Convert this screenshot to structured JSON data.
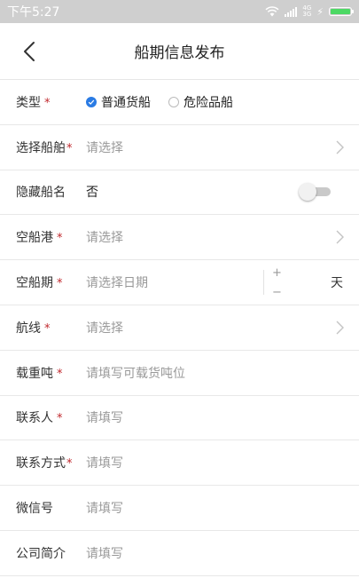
{
  "status": {
    "time": "下午5:27",
    "network_top": "4G",
    "network_bottom": "3G"
  },
  "header": {
    "title": "船期信息发布"
  },
  "form": {
    "required_mark": "*",
    "type": {
      "label": "类型",
      "options": [
        {
          "label": "普通货船",
          "selected": true
        },
        {
          "label": "危险品船",
          "selected": false
        }
      ]
    },
    "ship": {
      "label": "选择船舶",
      "placeholder": "请选择"
    },
    "hide_name": {
      "label": "隐藏船名",
      "value": "否",
      "toggle_on": false
    },
    "port": {
      "label": "空船港",
      "placeholder": "请选择"
    },
    "date": {
      "label": "空船期",
      "placeholder": "请选择日期",
      "plus": "+",
      "minus": "−",
      "unit": "天"
    },
    "route": {
      "label": "航线",
      "placeholder": "请选择"
    },
    "tonnage": {
      "label": "载重吨",
      "placeholder": "请填写可载货吨位"
    },
    "contact": {
      "label": "联系人",
      "placeholder": "请填写"
    },
    "contact_method": {
      "label": "联系方式",
      "placeholder": "请填写"
    },
    "wechat": {
      "label": "微信号",
      "placeholder": "请填写"
    },
    "company": {
      "label": "公司简介",
      "placeholder": "请填写"
    }
  },
  "colors": {
    "accent": "#2a7be4",
    "required": "#c0282d",
    "status_bar": "#cfcfcf",
    "battery": "#4cd964"
  }
}
